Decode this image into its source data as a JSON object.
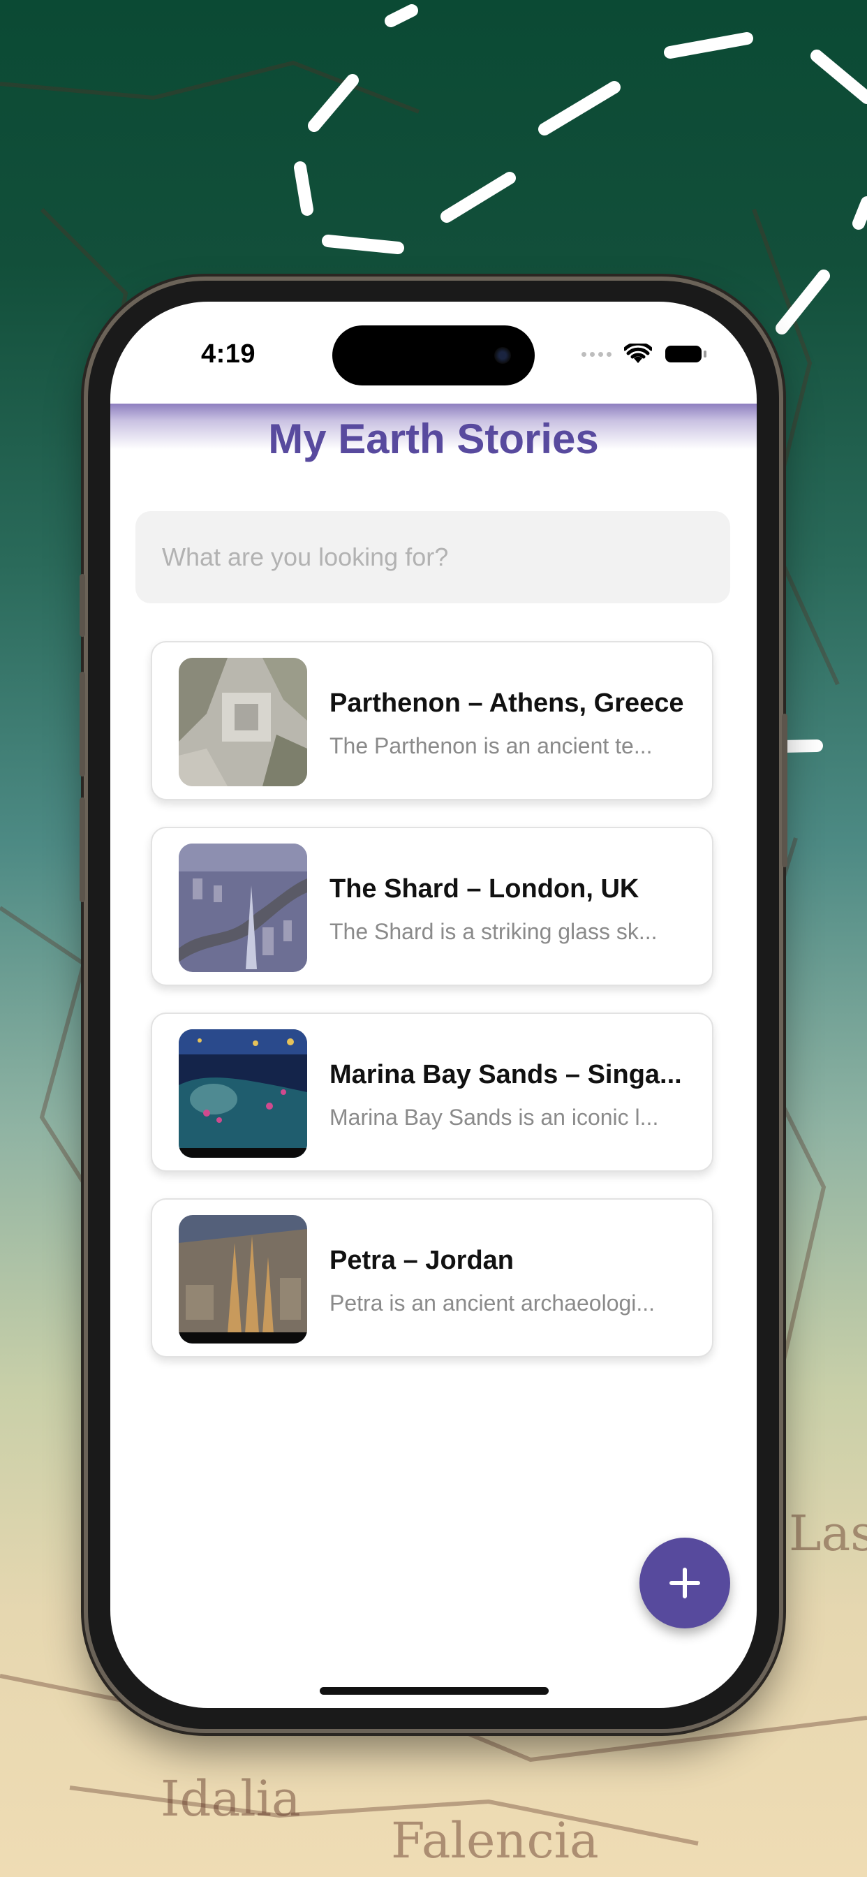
{
  "status_bar": {
    "time": "4:19",
    "wifi_icon": "wifi-icon",
    "battery_icon": "battery-icon"
  },
  "app": {
    "title": "My Earth Stories"
  },
  "search": {
    "placeholder": "What are you looking for?",
    "value": ""
  },
  "stories": [
    {
      "title": "Parthenon – Athens, Greece",
      "description": "The Parthenon is an ancient te...",
      "image": "aerial-ruins-photo"
    },
    {
      "title": "The Shard – London, UK",
      "description": "The Shard is a striking glass sk...",
      "image": "london-city-aerial-photo"
    },
    {
      "title": "Marina Bay Sands – Singa...",
      "description": "Marina Bay Sands is an iconic l...",
      "image": "singapore-night-photo"
    },
    {
      "title": "Petra – Jordan",
      "description": "Petra is an ancient archaeologi...",
      "image": "city-cathedral-photo"
    }
  ],
  "fab": {
    "icon": "plus-icon"
  },
  "colors": {
    "accent": "#574a9d",
    "title": "#584a9e",
    "background_top": "#0b4a34",
    "background_bottom": "#efdcb4"
  }
}
